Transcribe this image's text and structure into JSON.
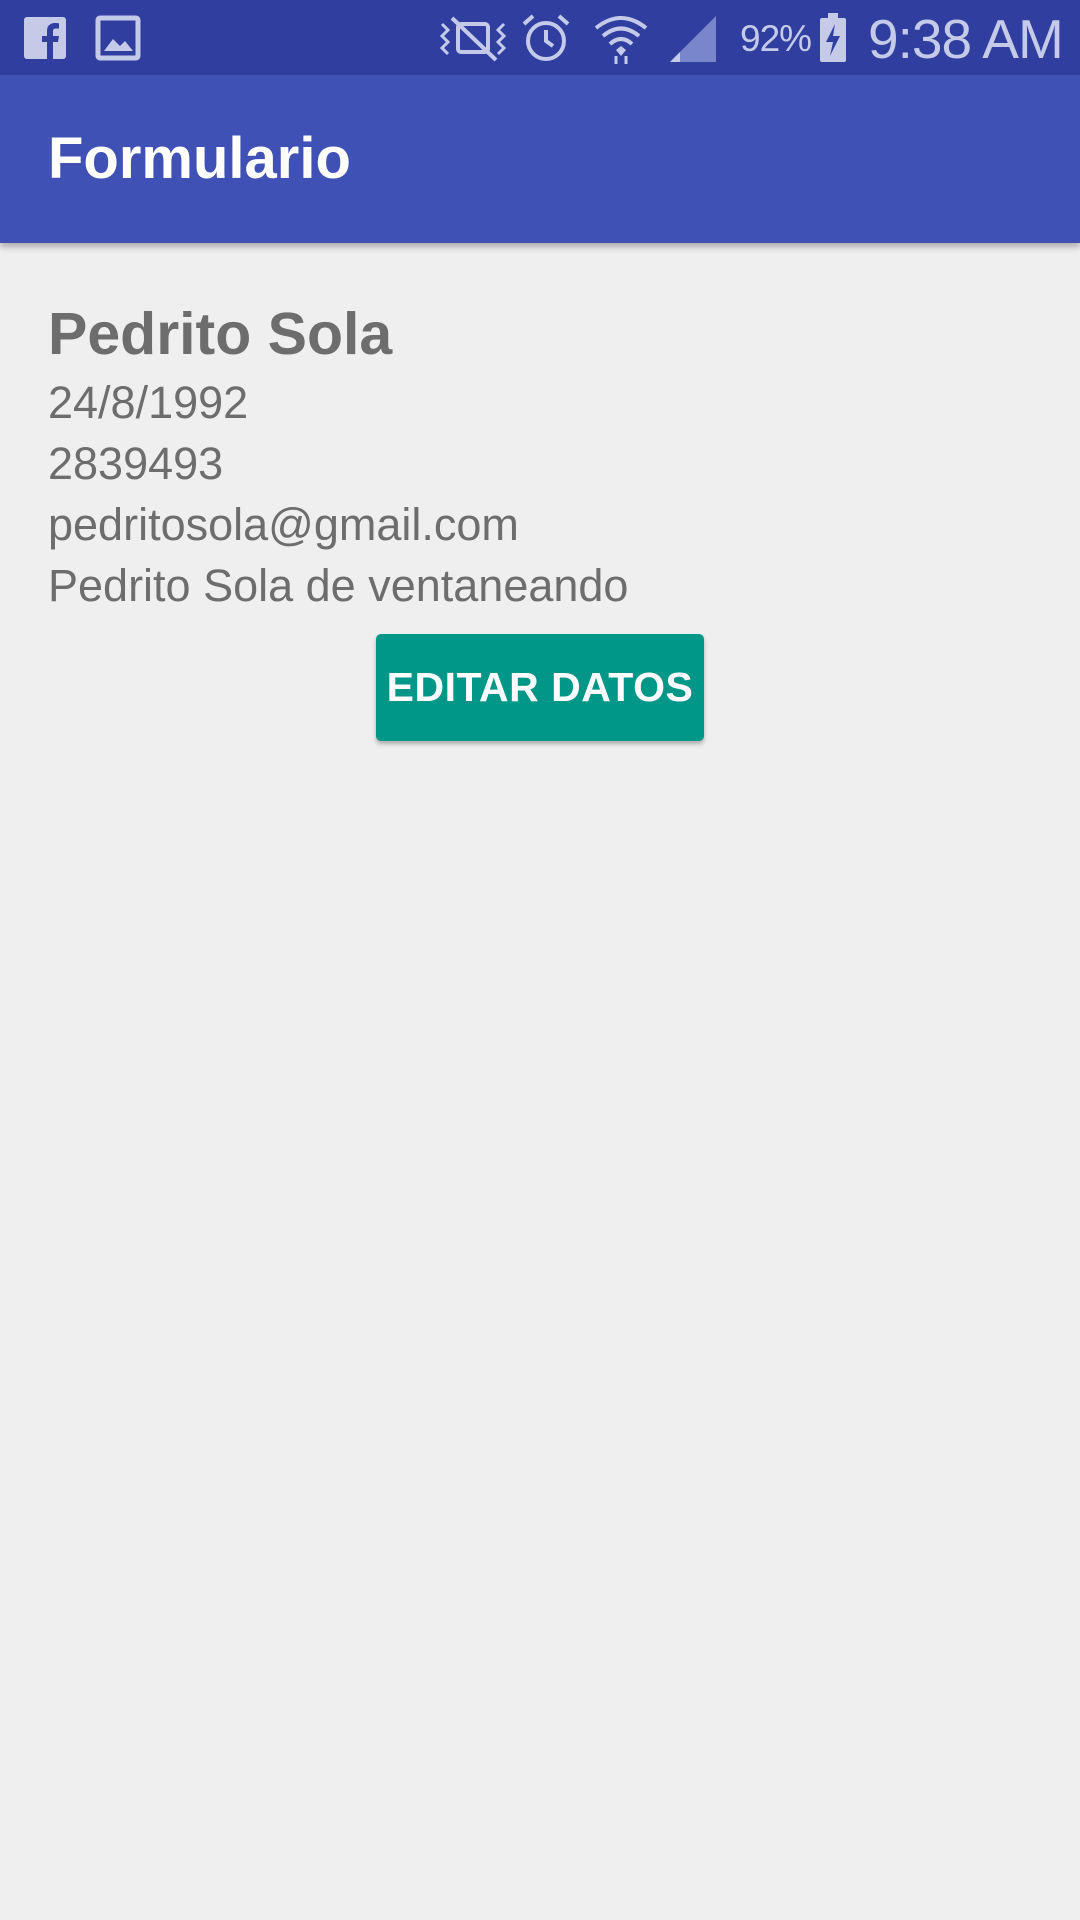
{
  "status_bar": {
    "left_icons": [
      "facebook-icon",
      "image-icon"
    ],
    "right_icons": [
      "vibrate-mute-icon",
      "alarm-icon",
      "wifi-icon",
      "cell-signal-icon",
      "battery-charging-icon"
    ],
    "battery_percent": "92%",
    "time": "9:38 AM",
    "color": "#c5cae9",
    "background": "#303f9f"
  },
  "app_bar": {
    "title": "Formulario",
    "background": "#3f51b5"
  },
  "profile": {
    "name": "Pedrito Sola",
    "birth_date": "24/8/1992",
    "phone": "2839493",
    "email": "pedritosola@gmail.com",
    "description": "Pedrito Sola de ventaneando"
  },
  "actions": {
    "edit_label": "EDITAR DATOS",
    "edit_color": "#009688"
  }
}
